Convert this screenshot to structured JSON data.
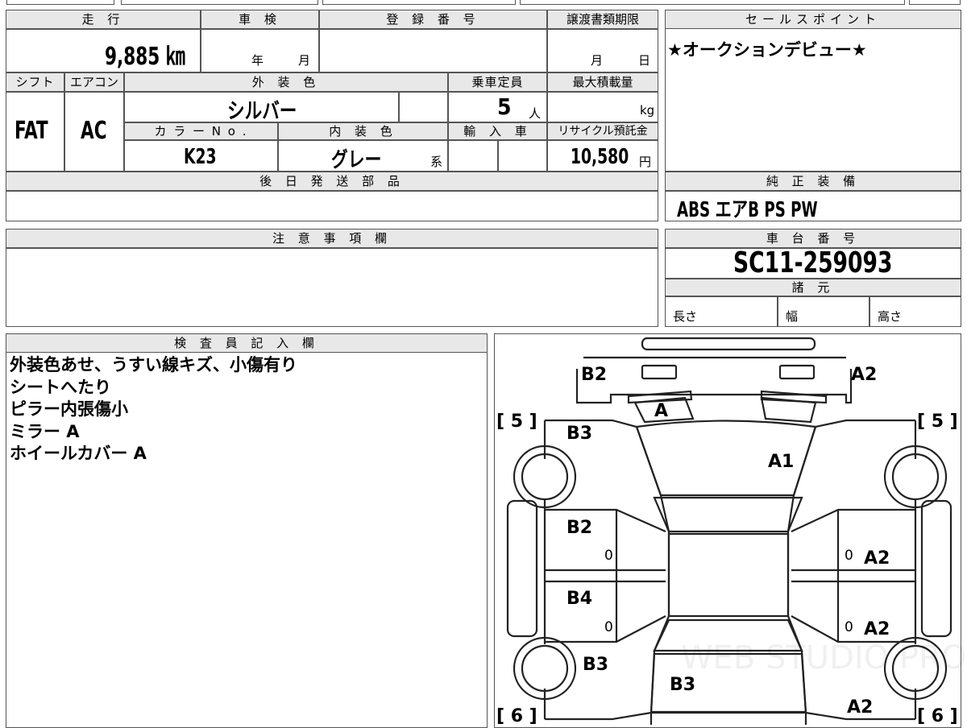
{
  "header": {
    "mileage_label": "走 行",
    "mileage_value": "9,885 ㎞",
    "inspection_label": "車 検",
    "inspection_year_unit": "年",
    "inspection_month_unit": "月",
    "registration_label": "登 録 番 号",
    "transfer_deadline_label": "譲渡書類期限",
    "transfer_month_unit": "月",
    "transfer_day_unit": "日",
    "shift_label": "シフト",
    "shift_value": "FAT",
    "ac_label": "エアコン",
    "ac_value": "AC",
    "exterior_color_label": "外 装 色",
    "exterior_color_value": "シルバー",
    "capacity_label": "乗車定員",
    "capacity_value": "5",
    "capacity_unit": "人",
    "max_load_label": "最大積載量",
    "max_load_unit": "kg",
    "color_no_label": "カ ラ ー N o .",
    "color_no_value": "K23",
    "interior_color_label": "内 装 色",
    "interior_color_value": "グレー",
    "interior_color_suffix": "系",
    "import_label": "輸 入 車",
    "recycle_label": "リサイクル預託金",
    "recycle_value": "10,580",
    "recycle_unit": "円",
    "later_parts_label": "後 日 発 送 部 品"
  },
  "sales_point": {
    "label": "セールスポイント",
    "text": "★オークションデビュー★"
  },
  "equipment": {
    "label": "純 正 装 備",
    "value": "ABS エアB PS PW"
  },
  "notes": {
    "label": "注 意 事 項 欄"
  },
  "chassis": {
    "label": "車 台 番 号",
    "value": "SC11-259093"
  },
  "specs": {
    "label": "諸 元",
    "length_label": "長さ",
    "width_label": "幅",
    "height_label": "高さ"
  },
  "inspector": {
    "label": "検 査 員 記 入 欄",
    "lines": [
      "外装色あせ、うすい線キズ、小傷有り",
      "シートへたり",
      "ピラー内張傷小",
      "ミラー A",
      "ホイールカバー A"
    ]
  },
  "diagram": {
    "marks": {
      "b2_top_left": "B2",
      "a2_top_right": "A2",
      "a_windshield": "A",
      "b3_left_front": "B3",
      "a1_hood": "A1",
      "b2_left_door": "B2",
      "b4_left_rear_door": "B4",
      "b3_left_rear": "B3",
      "b3_rear": "B3",
      "a2_right_door": "A2",
      "a2_right_rear_door": "A2",
      "a2_bottom_right": "A2",
      "zero_1": "0",
      "zero_2": "0",
      "zero_3": "0",
      "zero_4": "0"
    },
    "tire_front_left": "[ 5 ]",
    "tire_front_right": "[ 5 ]",
    "tire_rear_left": "[ 6 ]",
    "tire_rear_right": "[ 6 ]",
    "watermark": "WEB STUDIO PRO"
  }
}
